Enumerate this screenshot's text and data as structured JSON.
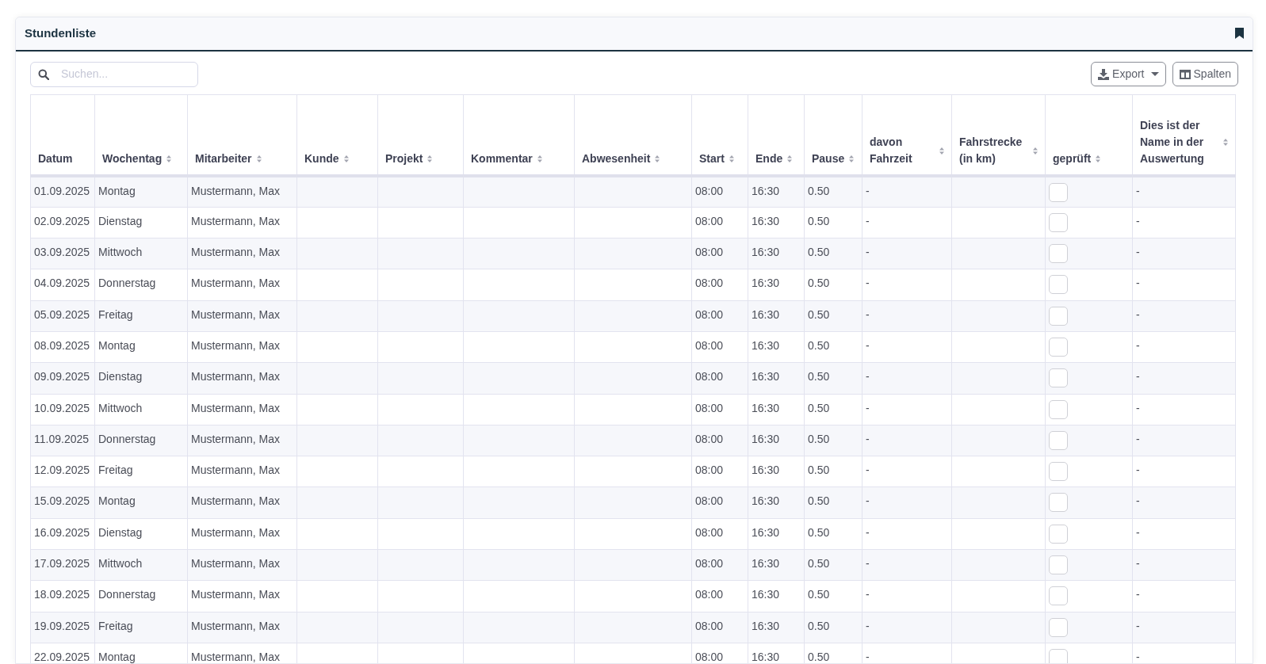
{
  "card": {
    "title": "Stundenliste"
  },
  "search": {
    "placeholder": "Suchen..."
  },
  "toolbar": {
    "export_button": "Export",
    "columns_button": "Spalten"
  },
  "table": {
    "columns": [
      {
        "label": "Datum",
        "sortable": false,
        "kind": "text"
      },
      {
        "label": "Wochentag",
        "sortable": true,
        "kind": "text"
      },
      {
        "label": "Mitarbeiter",
        "sortable": true,
        "kind": "text"
      },
      {
        "label": "Kunde",
        "sortable": true,
        "kind": "text"
      },
      {
        "label": "Projekt",
        "sortable": true,
        "kind": "text"
      },
      {
        "label": "Kommentar",
        "sortable": true,
        "kind": "text"
      },
      {
        "label": "Abwesenheit",
        "sortable": true,
        "kind": "text"
      },
      {
        "label": "Start",
        "sortable": true,
        "kind": "text"
      },
      {
        "label": "Ende",
        "sortable": true,
        "kind": "text"
      },
      {
        "label": "Pause",
        "sortable": true,
        "kind": "text"
      },
      {
        "label": "davon Fahrzeit",
        "sortable": true,
        "kind": "text"
      },
      {
        "label": "Fahrstrecke (in km)",
        "sortable": true,
        "kind": "text"
      },
      {
        "label": "geprüft",
        "sortable": true,
        "kind": "checkbox"
      },
      {
        "label": "Dies ist der Name in der Auswertung",
        "sortable": true,
        "kind": "text"
      }
    ],
    "rows": [
      {
        "checked": false,
        "cells": [
          "01.09.2025",
          "Montag",
          "Mustermann, Max",
          null,
          null,
          null,
          null,
          "08:00",
          "16:30",
          "0.50",
          "-",
          null,
          null,
          "-"
        ]
      },
      {
        "checked": false,
        "cells": [
          "02.09.2025",
          "Dienstag",
          "Mustermann, Max",
          null,
          null,
          null,
          null,
          "08:00",
          "16:30",
          "0.50",
          "-",
          null,
          null,
          "-"
        ]
      },
      {
        "checked": false,
        "cells": [
          "03.09.2025",
          "Mittwoch",
          "Mustermann, Max",
          null,
          null,
          null,
          null,
          "08:00",
          "16:30",
          "0.50",
          "-",
          null,
          null,
          "-"
        ]
      },
      {
        "checked": false,
        "cells": [
          "04.09.2025",
          "Donnerstag",
          "Mustermann, Max",
          null,
          null,
          null,
          null,
          "08:00",
          "16:30",
          "0.50",
          "-",
          null,
          null,
          "-"
        ]
      },
      {
        "checked": false,
        "cells": [
          "05.09.2025",
          "Freitag",
          "Mustermann, Max",
          null,
          null,
          null,
          null,
          "08:00",
          "16:30",
          "0.50",
          "-",
          null,
          null,
          "-"
        ]
      },
      {
        "checked": false,
        "cells": [
          "08.09.2025",
          "Montag",
          "Mustermann, Max",
          null,
          null,
          null,
          null,
          "08:00",
          "16:30",
          "0.50",
          "-",
          null,
          null,
          "-"
        ]
      },
      {
        "checked": false,
        "cells": [
          "09.09.2025",
          "Dienstag",
          "Mustermann, Max",
          null,
          null,
          null,
          null,
          "08:00",
          "16:30",
          "0.50",
          "-",
          null,
          null,
          "-"
        ]
      },
      {
        "checked": false,
        "cells": [
          "10.09.2025",
          "Mittwoch",
          "Mustermann, Max",
          null,
          null,
          null,
          null,
          "08:00",
          "16:30",
          "0.50",
          "-",
          null,
          null,
          "-"
        ]
      },
      {
        "checked": false,
        "cells": [
          "11.09.2025",
          "Donnerstag",
          "Mustermann, Max",
          null,
          null,
          null,
          null,
          "08:00",
          "16:30",
          "0.50",
          "-",
          null,
          null,
          "-"
        ]
      },
      {
        "checked": false,
        "cells": [
          "12.09.2025",
          "Freitag",
          "Mustermann, Max",
          null,
          null,
          null,
          null,
          "08:00",
          "16:30",
          "0.50",
          "-",
          null,
          null,
          "-"
        ]
      },
      {
        "checked": false,
        "cells": [
          "15.09.2025",
          "Montag",
          "Mustermann, Max",
          null,
          null,
          null,
          null,
          "08:00",
          "16:30",
          "0.50",
          "-",
          null,
          null,
          "-"
        ]
      },
      {
        "checked": false,
        "cells": [
          "16.09.2025",
          "Dienstag",
          "Mustermann, Max",
          null,
          null,
          null,
          null,
          "08:00",
          "16:30",
          "0.50",
          "-",
          null,
          null,
          "-"
        ]
      },
      {
        "checked": false,
        "cells": [
          "17.09.2025",
          "Mittwoch",
          "Mustermann, Max",
          null,
          null,
          null,
          null,
          "08:00",
          "16:30",
          "0.50",
          "-",
          null,
          null,
          "-"
        ]
      },
      {
        "checked": false,
        "cells": [
          "18.09.2025",
          "Donnerstag",
          "Mustermann, Max",
          null,
          null,
          null,
          null,
          "08:00",
          "16:30",
          "0.50",
          "-",
          null,
          null,
          "-"
        ]
      },
      {
        "checked": false,
        "cells": [
          "19.09.2025",
          "Freitag",
          "Mustermann, Max",
          null,
          null,
          null,
          null,
          "08:00",
          "16:30",
          "0.50",
          "-",
          null,
          null,
          "-"
        ]
      },
      {
        "checked": false,
        "cells": [
          "22.09.2025",
          "Montag",
          "Mustermann, Max",
          null,
          null,
          null,
          null,
          "08:00",
          "16:30",
          "0.50",
          "-",
          null,
          null,
          "-"
        ]
      }
    ]
  }
}
